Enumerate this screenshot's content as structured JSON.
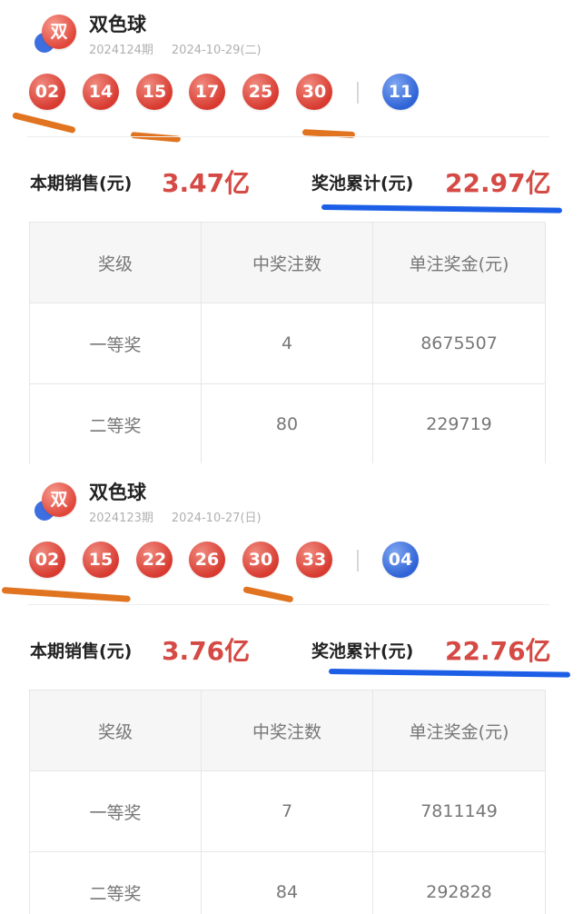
{
  "draws": [
    {
      "lottery_name": "双色球",
      "logo_char": "双",
      "issue": "2024124期",
      "date": "2024-10-29(二)",
      "red_balls": [
        "02",
        "14",
        "15",
        "17",
        "25",
        "30"
      ],
      "blue_ball": "11",
      "sales_label": "本期销售(元)",
      "sales_value": "3.47亿",
      "pool_label": "奖池累计(元)",
      "pool_value": "22.97亿",
      "table": {
        "headers": [
          "奖级",
          "中奖注数",
          "单注奖金(元)"
        ],
        "rows": [
          [
            "一等奖",
            "4",
            "8675507"
          ],
          [
            "二等奖",
            "80",
            "229719"
          ]
        ]
      }
    },
    {
      "lottery_name": "双色球",
      "logo_char": "双",
      "issue": "2024123期",
      "date": "2024-10-27(日)",
      "red_balls": [
        "02",
        "15",
        "22",
        "26",
        "30",
        "33"
      ],
      "blue_ball": "04",
      "sales_label": "本期销售(元)",
      "sales_value": "3.76亿",
      "pool_label": "奖池累计(元)",
      "pool_value": "22.76亿",
      "table": {
        "headers": [
          "奖级",
          "中奖注数",
          "单注奖金(元)"
        ],
        "rows": [
          [
            "一等奖",
            "7",
            "7811149"
          ],
          [
            "二等奖",
            "84",
            "292828"
          ]
        ]
      }
    }
  ],
  "colors": {
    "red_ball": "#d83a30",
    "blue_ball": "#2f63d6",
    "amount": "#d54a44",
    "annotation_orange": "#e07420",
    "annotation_blue": "#1c5fe6"
  }
}
